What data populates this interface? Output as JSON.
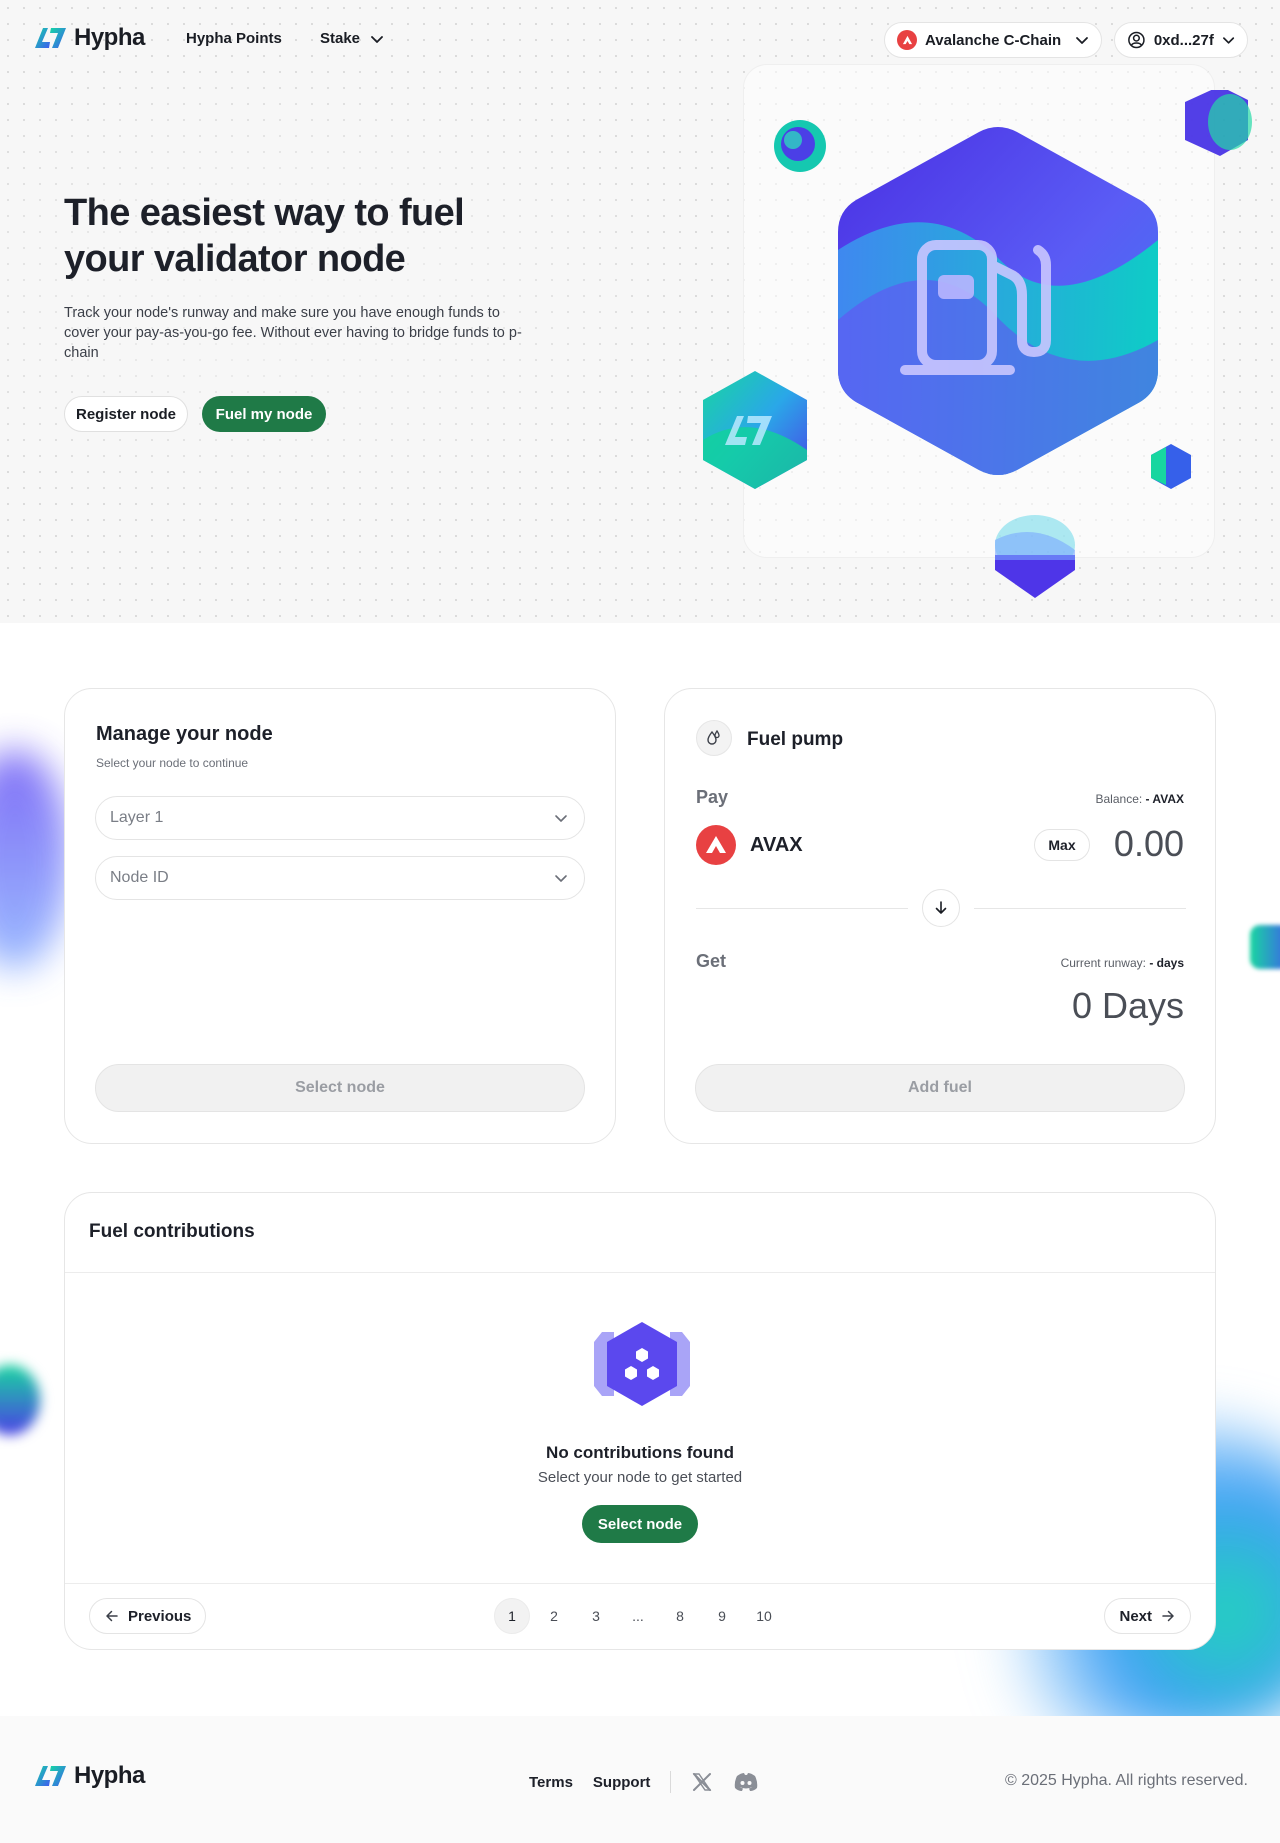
{
  "brand": {
    "name": "Hypha"
  },
  "nav": {
    "links": [
      {
        "label": "Hypha Points"
      },
      {
        "label": "Stake"
      }
    ],
    "network": "Avalanche C-Chain",
    "account": "0xd...27f"
  },
  "hero": {
    "title": "The easiest way to fuel your validator node",
    "subtitle": "Track your node's runway and make sure you have enough funds to cover your pay-as-you-go fee. Without ever having to bridge funds to p-chain",
    "register_label": "Register node",
    "fuel_label": "Fuel my node"
  },
  "manage": {
    "title": "Manage your node",
    "subtitle": "Select your node to continue",
    "layer_placeholder": "Layer 1",
    "node_placeholder": "Node ID",
    "button": "Select node"
  },
  "pump": {
    "title": "Fuel pump",
    "pay_label": "Pay",
    "balance_prefix": "Balance:",
    "balance_value": "- AVAX",
    "token": "AVAX",
    "max_label": "Max",
    "amount": "0.00",
    "get_label": "Get",
    "runway_prefix": "Current runway:",
    "runway_value": "- days",
    "days": "0 Days",
    "button": "Add fuel"
  },
  "contributions": {
    "title": "Fuel contributions",
    "empty_title": "No contributions found",
    "empty_sub": "Select your node to get started",
    "empty_button": "Select node",
    "previous": "Previous",
    "next": "Next",
    "pages": [
      "1",
      "2",
      "3",
      "...",
      "8",
      "9",
      "10"
    ],
    "current_page": "1"
  },
  "footer": {
    "terms": "Terms",
    "support": "Support",
    "copyright": "© 2025 Hypha. All rights reserved."
  },
  "colors": {
    "accent_green": "#1f7a47",
    "avax_red": "#e84142",
    "purple": "#5b3ff0",
    "teal": "#10c9b8"
  },
  "icons": [
    "hypha-logo",
    "chevron-down-icon",
    "avalanche-icon",
    "user-circle-icon",
    "fuel-pump-icon",
    "drops-icon",
    "arrow-down-icon",
    "hexagon-cluster-icon",
    "arrow-left-icon",
    "arrow-right-icon",
    "x-icon",
    "discord-icon"
  ]
}
